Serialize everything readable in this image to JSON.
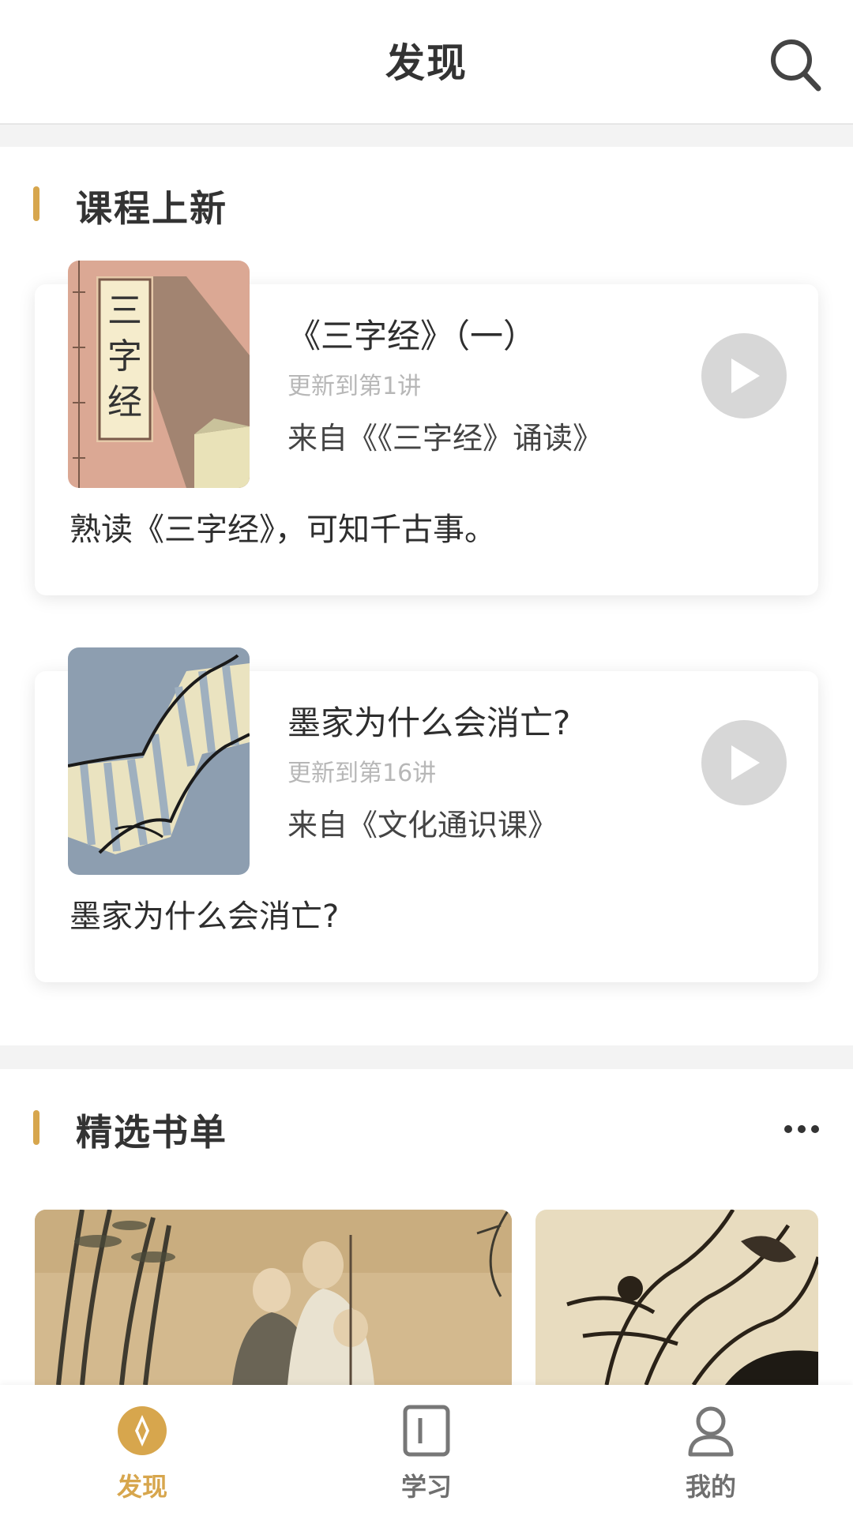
{
  "header": {
    "title": "发现",
    "search_icon": "search-icon"
  },
  "section_new": {
    "title": "课程上新",
    "courses": [
      {
        "cover_text": "三字经",
        "title": "《三字经》（一）",
        "update": "更新到第1讲",
        "from": "来自《《三字经》诵读》",
        "desc": "熟读《三字经》，可知千古事。"
      },
      {
        "title": "墨家为什么会消亡?",
        "update": "更新到第16讲",
        "from": "来自《文化通识课》",
        "desc": "墨家为什么会消亡?"
      }
    ]
  },
  "section_books": {
    "title": "精选书单",
    "more_icon": "more-icon"
  },
  "tabbar": {
    "active_color": "#d7a64d",
    "tabs": [
      {
        "label": "发现",
        "icon": "compass-icon",
        "active": true
      },
      {
        "label": "学习",
        "icon": "book-icon",
        "active": false
      },
      {
        "label": "我的",
        "icon": "user-icon",
        "active": false
      }
    ]
  }
}
